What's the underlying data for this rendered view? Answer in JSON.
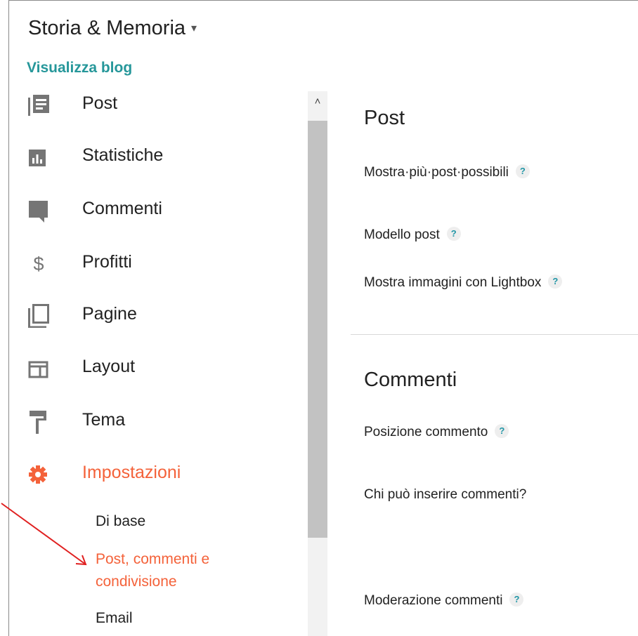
{
  "header": {
    "blog_title": "Storia & Memoria",
    "dropdown_icon": "caret-down-icon",
    "view_blog": "Visualizza blog"
  },
  "sidebar": {
    "items": [
      {
        "label": "Post",
        "icon": "posts-icon"
      },
      {
        "label": "Statistiche",
        "icon": "stats-icon"
      },
      {
        "label": "Commenti",
        "icon": "comment-icon"
      },
      {
        "label": "Profitti",
        "icon": "dollar-icon"
      },
      {
        "label": "Pagine",
        "icon": "pages-icon"
      },
      {
        "label": "Layout",
        "icon": "layout-icon"
      },
      {
        "label": "Tema",
        "icon": "paint-roller-icon"
      },
      {
        "label": "Impostazioni",
        "icon": "gear-icon",
        "active": true
      }
    ],
    "subitems": [
      {
        "label": "Di base"
      },
      {
        "label_line1": "Post, commenti e",
        "label_line2": "condivisione",
        "active": true
      },
      {
        "label": "Email"
      }
    ]
  },
  "main": {
    "sections": [
      {
        "title": "Post",
        "settings": [
          "Mostra·più·post·possibili",
          "Modello post",
          "Mostra immagini con Lightbox"
        ]
      },
      {
        "title": "Commenti",
        "settings": [
          "Posizione commento",
          "Chi può inserire commenti?",
          "Moderazione commenti"
        ]
      }
    ],
    "help_glyph": "?"
  },
  "colors": {
    "accent_active": "#f4623a",
    "link_teal": "#26979a",
    "icon_grey": "#757575",
    "annotation_arrow": "#e02020"
  }
}
